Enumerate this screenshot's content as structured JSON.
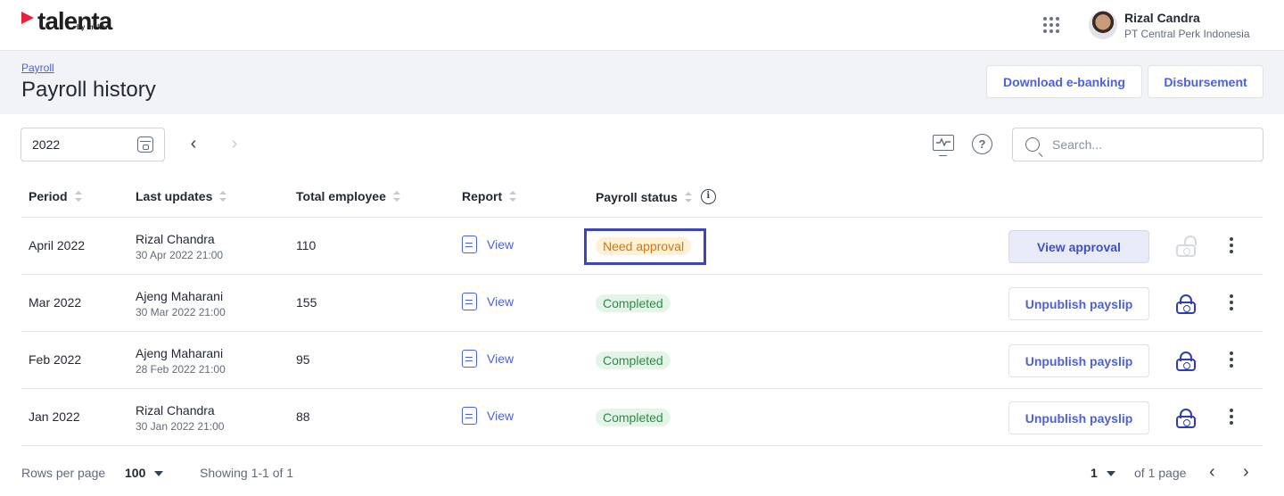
{
  "brand": {
    "name": "talenta",
    "sub": "by mekari"
  },
  "user": {
    "name": "Rizal Candra",
    "company": "PT Central Perk Indonesia"
  },
  "header": {
    "breadcrumb": "Payroll",
    "title": "Payroll history",
    "download_label": "Download e-banking",
    "disbursement_label": "Disbursement"
  },
  "filter": {
    "year": "2022",
    "search_placeholder": "Search..."
  },
  "table": {
    "columns": [
      "Period",
      "Last updates",
      "Total employee",
      "Report",
      "Payroll status"
    ],
    "rows": [
      {
        "period": "April 2022",
        "updated_by": "Rizal Chandra",
        "updated_at": "30 Apr 2022 21:00",
        "total": "110",
        "report": "View",
        "status": "Need approval",
        "action": "View approval"
      },
      {
        "period": "Mar 2022",
        "updated_by": "Ajeng Maharani",
        "updated_at": "30 Mar 2022 21:00",
        "total": "155",
        "report": "View",
        "status": "Completed",
        "action": "Unpublish payslip"
      },
      {
        "period": "Feb 2022",
        "updated_by": "Ajeng Maharani",
        "updated_at": "28 Feb 2022 21:00",
        "total": "95",
        "report": "View",
        "status": "Completed",
        "action": "Unpublish payslip"
      },
      {
        "period": "Jan 2022",
        "updated_by": "Rizal Chandra",
        "updated_at": "30 Jan 2022 21:00",
        "total": "88",
        "report": "View",
        "status": "Completed",
        "action": "Unpublish payslip"
      }
    ]
  },
  "footer": {
    "rows_per_page_label": "Rows per page",
    "rows_per_page": "100",
    "showing": "Showing 1-1 of 1",
    "page": "1",
    "of_pages": "of 1 page"
  },
  "colors": {
    "accent": "#4b61dd",
    "warning": "#c8781c",
    "success": "#2d8a4a",
    "highlight": "#3d46b9"
  }
}
